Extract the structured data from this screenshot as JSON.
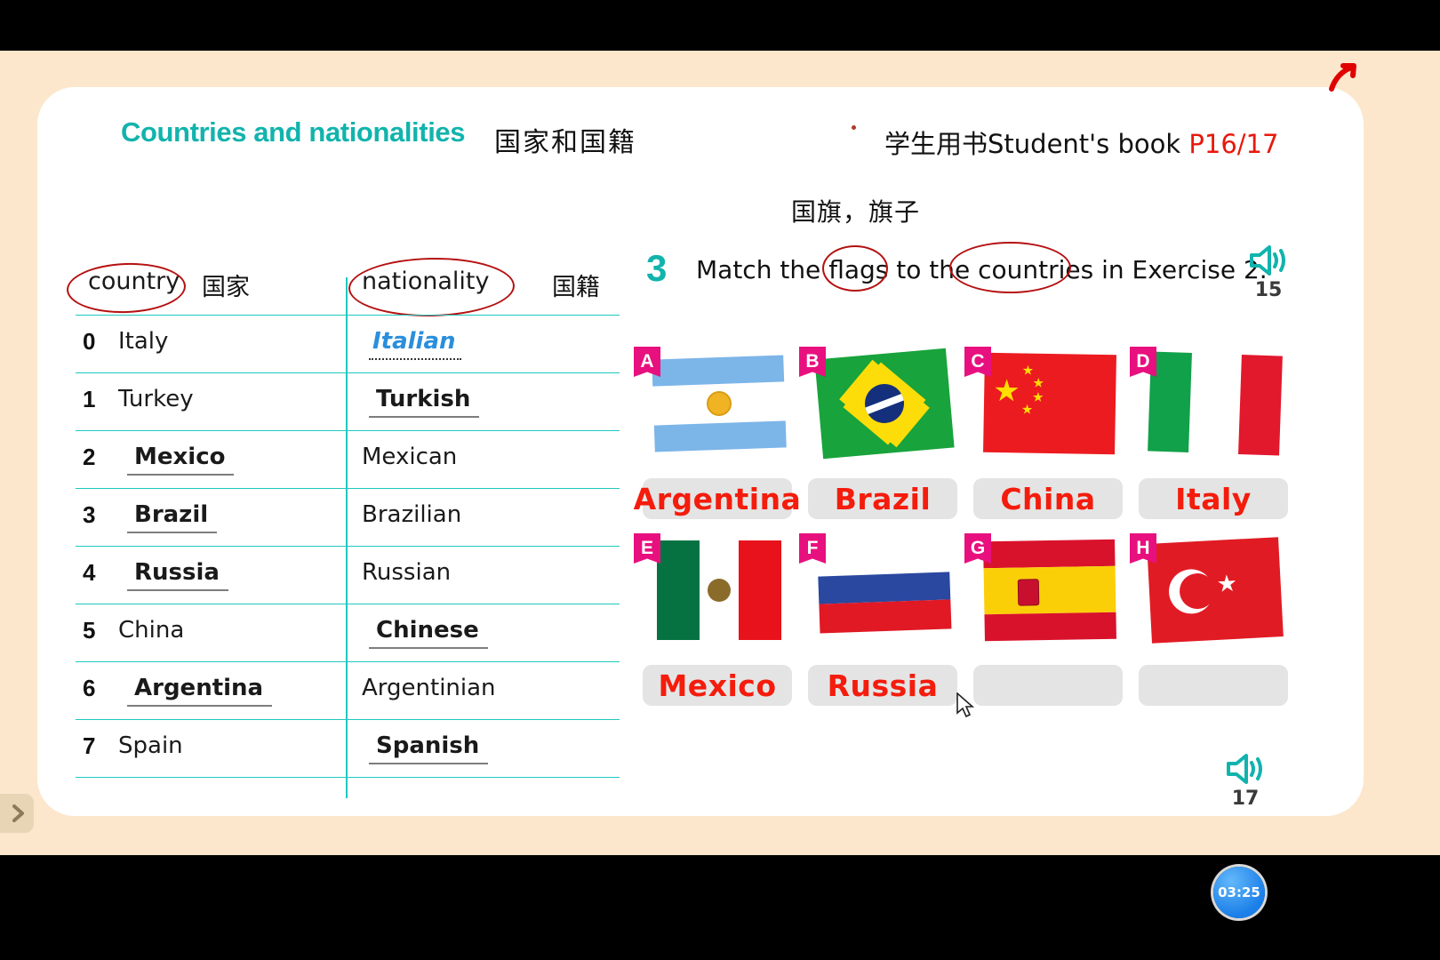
{
  "header": {
    "title_en": "Countries and nationalities",
    "title_cn": "国家和国籍",
    "book_cn": "学生用书",
    "book_en": "Student's book",
    "book_pages": "P16/17",
    "flag_cn": "国旗，旗子"
  },
  "table": {
    "col1_header": "country",
    "col1_header_cn": "国家",
    "col2_header": "nationality",
    "col2_header_cn": "国籍",
    "rows": [
      {
        "num": "0",
        "country": "Italy",
        "country_filled": false,
        "nationality": "Italian",
        "nationality_filled": "model"
      },
      {
        "num": "1",
        "country": "Turkey",
        "country_filled": false,
        "nationality": "Turkish",
        "nationality_filled": "answer"
      },
      {
        "num": "2",
        "country": "Mexico",
        "country_filled": true,
        "nationality": "Mexican",
        "nationality_filled": "none"
      },
      {
        "num": "3",
        "country": "Brazil",
        "country_filled": true,
        "nationality": "Brazilian",
        "nationality_filled": "none"
      },
      {
        "num": "4",
        "country": "Russia",
        "country_filled": true,
        "nationality": "Russian",
        "nationality_filled": "none"
      },
      {
        "num": "5",
        "country": "China",
        "country_filled": false,
        "nationality": "Chinese",
        "nationality_filled": "answer"
      },
      {
        "num": "6",
        "country": "Argentina",
        "country_filled": true,
        "nationality": "Argentinian",
        "nationality_filled": "none"
      },
      {
        "num": "7",
        "country": "Spain",
        "country_filled": false,
        "nationality": "Spanish",
        "nationality_filled": "answer"
      }
    ]
  },
  "exercise": {
    "number": "3",
    "instruction": "Match the flags to the countries in Exercise 2.",
    "audio_top": "15",
    "audio_bottom": "17",
    "flags": [
      {
        "tag": "A",
        "country": "argentina",
        "answer": "Argentina"
      },
      {
        "tag": "B",
        "country": "brazil",
        "answer": "Brazil"
      },
      {
        "tag": "C",
        "country": "china",
        "answer": "China"
      },
      {
        "tag": "D",
        "country": "italy",
        "answer": "Italy"
      },
      {
        "tag": "E",
        "country": "mexico",
        "answer": "Mexico"
      },
      {
        "tag": "F",
        "country": "russia",
        "answer": "Russia"
      },
      {
        "tag": "G",
        "country": "spain",
        "answer": ""
      },
      {
        "tag": "H",
        "country": "turkey",
        "answer": ""
      }
    ]
  },
  "timer": {
    "value": "03:25"
  },
  "colors": {
    "accent_teal": "#12b3ad",
    "annotation_red": "#b51010",
    "answer_red": "#f41c0c",
    "tag_pink": "#e8107f",
    "page_red": "#e8180c",
    "model_blue": "#2a8fdc",
    "frame_beige": "#fce7cd"
  }
}
